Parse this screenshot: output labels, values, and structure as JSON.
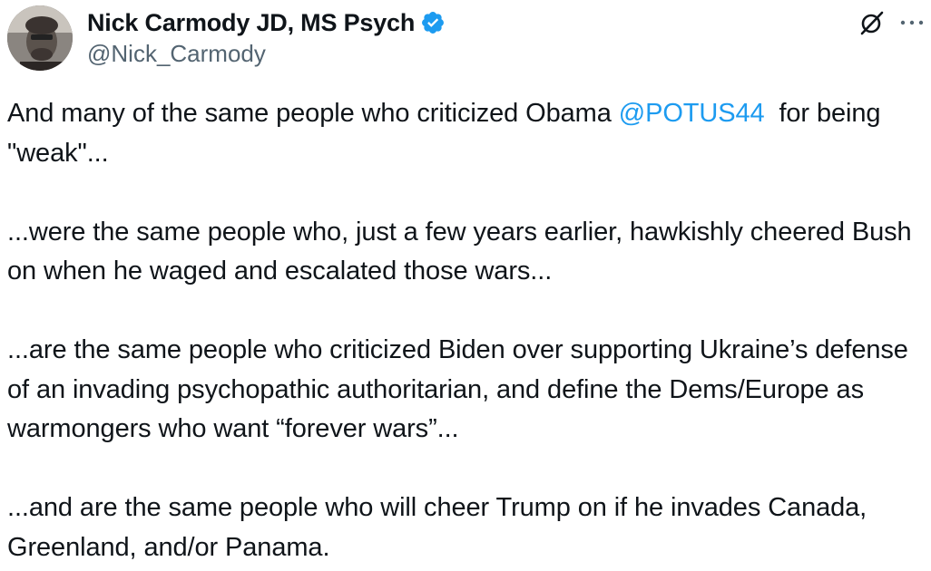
{
  "author": {
    "display_name": "Nick Carmody JD, MS Psych",
    "handle": "@Nick_Carmody",
    "verified": true,
    "verified_icon": "verified-badge-icon",
    "avatar_icon": "profile-photo"
  },
  "header_actions": {
    "grok_icon": "grok-icon",
    "more_icon": "more-options-icon"
  },
  "tweet": {
    "p1_before": "And many of the same people who criticized Obama ",
    "p1_mention": "@POTUS44",
    "p1_after": "  for being \"weak\"...",
    "p2": "...were the same people who, just a few years earlier, hawkishly cheered Bush on when he waged and escalated those wars...",
    "p3": "...are the same people who criticized Biden over supporting Ukraine’s defense of an invading psychopathic authoritarian, and define the Dems/Europe as warmongers who want “forever wars”...",
    "p4": "...and are the same people who will cheer Trump on if he invades Canada, Greenland, and/or Panama."
  },
  "colors": {
    "text": "#0f1419",
    "secondary": "#536471",
    "link": "#1d9bf0",
    "verified": "#1d9bf0"
  }
}
